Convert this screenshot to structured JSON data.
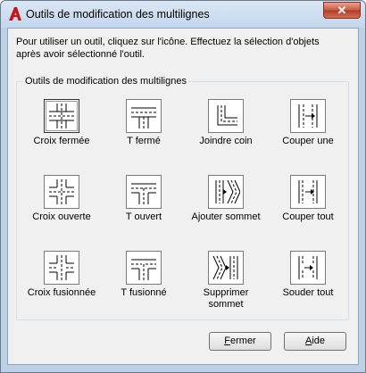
{
  "window": {
    "title": "Outils de modification des multilignes",
    "close_label": "✕"
  },
  "instructions": "Pour utiliser un outil, cliquez sur l'icône. Effectuez la sélection d'objets après avoir sélectionné l'outil.",
  "group_title": "Outils de modification des multilignes",
  "tools": [
    {
      "label": "Croix fermée",
      "icon": "closed-cross-icon"
    },
    {
      "label": "T fermé",
      "icon": "closed-tee-icon"
    },
    {
      "label": "Joindre coin",
      "icon": "corner-joint-icon"
    },
    {
      "label": "Couper une",
      "icon": "cut-single-icon"
    },
    {
      "label": "Croix ouverte",
      "icon": "open-cross-icon"
    },
    {
      "label": "T ouvert",
      "icon": "open-tee-icon"
    },
    {
      "label": "Ajouter sommet",
      "icon": "add-vertex-icon"
    },
    {
      "label": "Couper tout",
      "icon": "cut-all-icon"
    },
    {
      "label": "Croix fusionnée",
      "icon": "merged-cross-icon"
    },
    {
      "label": "T fusionné",
      "icon": "merged-tee-icon"
    },
    {
      "label": "Supprimer sommet",
      "icon": "delete-vertex-icon"
    },
    {
      "label": "Souder tout",
      "icon": "weld-all-icon"
    }
  ],
  "buttons": {
    "close_mnemonic": "F",
    "close_rest": "ermer",
    "help_mnemonic": "A",
    "help_rest": "ide"
  },
  "colors": {
    "accent_red": "#c4161c"
  }
}
